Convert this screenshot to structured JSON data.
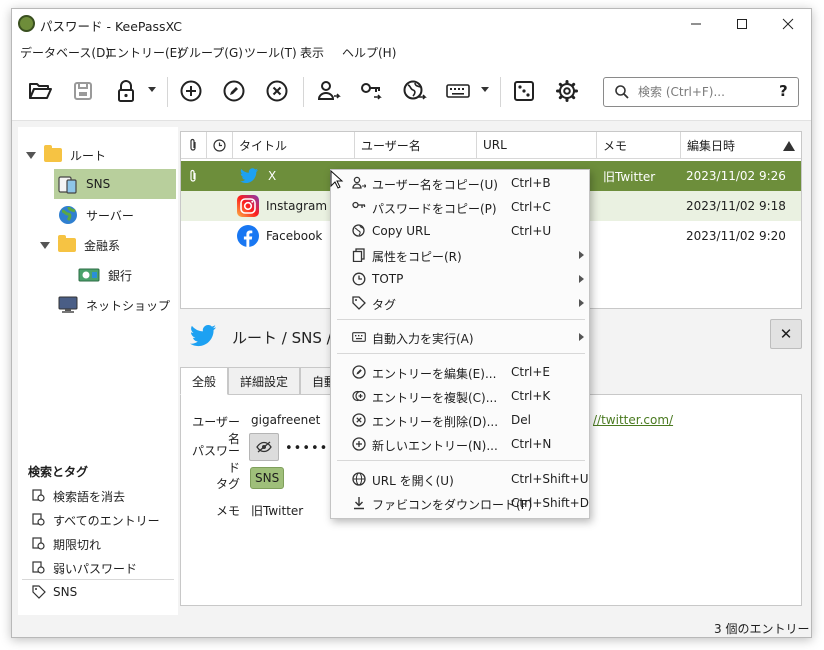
{
  "window": {
    "title": "パスワード - KeePassXC"
  },
  "menubar": [
    "データベース(D)",
    "エントリー(E)",
    "グループ(G)",
    "ツール(T)",
    "表示",
    "ヘルプ(H)"
  ],
  "search": {
    "placeholder": "検索 (Ctrl+F)...",
    "help": "?"
  },
  "groups": [
    {
      "label": "ルート"
    },
    {
      "label": "SNS"
    },
    {
      "label": "サーバー"
    },
    {
      "label": "金融系"
    },
    {
      "label": "銀行"
    },
    {
      "label": "ネットショップ"
    }
  ],
  "search_tags": {
    "title": "検索とタグ",
    "items": [
      "検索語を消去",
      "すべてのエントリー",
      "期限切れ",
      "弱いパスワード",
      "SNS"
    ]
  },
  "table": {
    "headers": [
      "タイトル",
      "ユーザー名",
      "URL",
      "メモ",
      "編集日時"
    ],
    "rows": [
      {
        "title": "X",
        "memo": "旧Twitter",
        "modified": "2023/11/02 9:26"
      },
      {
        "title": "Instagram",
        "memo": "",
        "modified": "2023/11/02 9:18"
      },
      {
        "title": "Facebook",
        "memo": "",
        "modified": "2023/11/02 9:20"
      }
    ]
  },
  "details": {
    "path": "ルート / SNS / X",
    "tabs": [
      "全般",
      "詳細設定",
      "自動"
    ],
    "username_label": "ユーザー名",
    "username": "gigafreenet",
    "password_label": "パスワード",
    "password": "••••••",
    "tag_label": "タグ",
    "tag": "SNS",
    "memo_label": "メモ",
    "memo": "旧Twitter",
    "url_fragment": "//twitter.com/",
    "close": "✕"
  },
  "status": {
    "count": "3 個のエントリー"
  },
  "context_menu": [
    {
      "label": "ユーザー名をコピー(U)",
      "shortcut": "Ctrl+B",
      "icon": "user-copy-icon"
    },
    {
      "label": "パスワードをコピー(P)",
      "shortcut": "Ctrl+C",
      "icon": "key-copy-icon"
    },
    {
      "label": "Copy URL",
      "shortcut": "Ctrl+U",
      "icon": "globe-copy-icon"
    },
    {
      "label": "属性をコピー(R)",
      "shortcut": "",
      "icon": "copy-icon"
    },
    {
      "label": "TOTP",
      "shortcut": "",
      "icon": "clock-icon"
    },
    {
      "label": "タグ",
      "shortcut": "",
      "icon": "tag-icon"
    },
    {
      "label": "自動入力を実行(A)",
      "shortcut": "",
      "icon": "keyboard-icon"
    },
    {
      "label": "エントリーを編集(E)...",
      "shortcut": "Ctrl+E",
      "icon": "edit-icon"
    },
    {
      "label": "エントリーを複製(C)...",
      "shortcut": "Ctrl+K",
      "icon": "clone-icon"
    },
    {
      "label": "エントリーを削除(D)...",
      "shortcut": "Del",
      "icon": "delete-icon"
    },
    {
      "label": "新しいエントリー(N)...",
      "shortcut": "Ctrl+N",
      "icon": "add-icon"
    },
    {
      "label": "URL を開く(U)",
      "shortcut": "Ctrl+Shift+U",
      "icon": "globe-icon"
    },
    {
      "label": "ファビコンをダウンロード(F)",
      "shortcut": "Ctrl+Shift+D",
      "icon": "download-icon"
    }
  ],
  "colors": {
    "accent": "#6d8e3b",
    "selection_light": "#b8cf9c",
    "link": "#4a7a20"
  }
}
